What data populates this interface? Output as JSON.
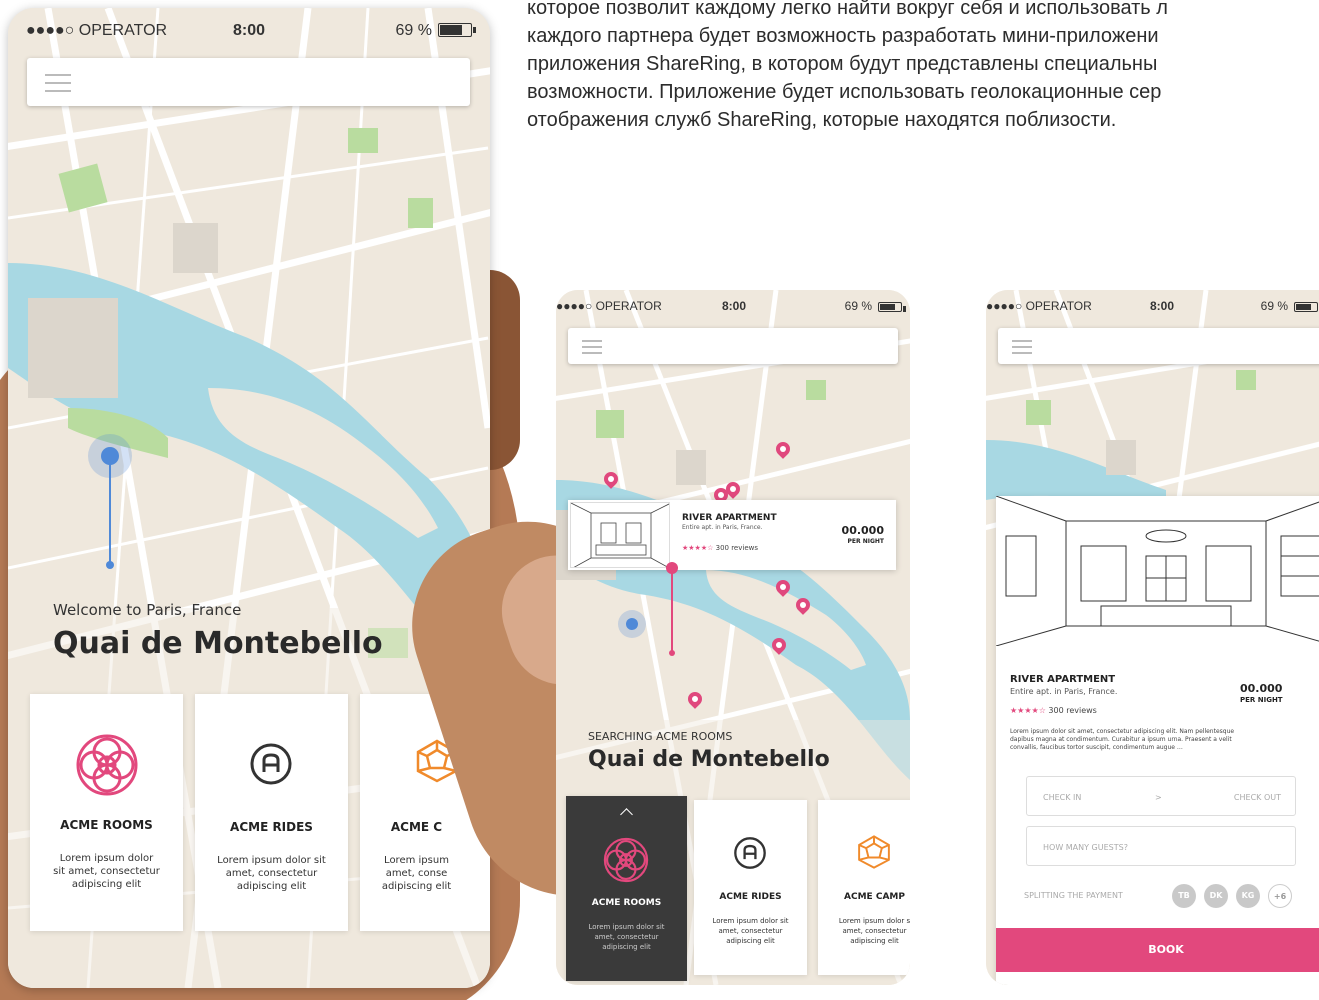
{
  "colors": {
    "accent": "#e2487d",
    "blue_marker": "#4f89d8",
    "map_bg": "#efe8dd",
    "water": "#a8d8e3",
    "park": "#b9dc9f"
  },
  "description_paragraph": [
    "которое позволит каждому легко найти вокруг себя и использовать л",
    "каждого партнера будет возможность разработать мини-приложени",
    "приложения  ShareRing, в котором будут представлены специальны",
    "возможности. Приложение будет использовать геолокационные сер",
    "отображения служб ShareRing, которые находятся поблизости."
  ],
  "status_bar": {
    "operator": "●●●●○ OPERATOR",
    "time": "8:00",
    "battery": "69 %"
  },
  "phone_left": {
    "welcome": "Welcome to Paris, France",
    "place": "Quai de Montebello",
    "cards": [
      {
        "title": "ACME ROOMS",
        "icon": "flower-icon",
        "desc": [
          "Lorem ipsum dolor",
          "sit amet, consectetur",
          "adipiscing elit"
        ]
      },
      {
        "title": "ACME RIDES",
        "icon": "circle-a-icon",
        "desc": [
          "Lorem ipsum dolor sit",
          "amet, consectetur",
          "adipiscing elit"
        ]
      },
      {
        "title": "ACME C",
        "icon": "polyhedron-icon",
        "desc": [
          "Lorem ipsum",
          "amet, conse",
          "adipiscing elit"
        ]
      }
    ]
  },
  "phone_mid": {
    "searching": "SEARCHING ACME ROOMS",
    "place": "Quai de Montebello",
    "listing": {
      "title": "RIVER APARTMENT",
      "subtitle": "Entire apt. in Paris, France.",
      "rating_stars": "★★★★☆",
      "reviews": "300 reviews",
      "price": "00.000",
      "price_unit": "PER NIGHT"
    },
    "cards": [
      {
        "title": "ACME ROOMS",
        "icon": "flower-icon",
        "desc": [
          "Lorem ipsum dolor sit",
          "amet, consectetur",
          "adipiscing elit"
        ]
      },
      {
        "title": "ACME RIDES",
        "icon": "circle-a-icon",
        "desc": [
          "Lorem ipsum dolor sit",
          "amet, consectetur",
          "adipiscing elit"
        ]
      },
      {
        "title": "ACME CAMP",
        "icon": "polyhedron-icon",
        "desc": [
          "Lorem ipsum dolor s",
          "amet, consectetur",
          "adipiscing elit"
        ]
      }
    ]
  },
  "phone_right": {
    "listing": {
      "title": "RIVER APARTMENT",
      "subtitle": "Entire apt. in Paris, France.",
      "rating_stars": "★★★★☆",
      "reviews": "300 reviews",
      "price": "00.000",
      "price_unit": "PER NIGHT"
    },
    "description": [
      "Lorem ipsum dolor sit amet, consectetur adipiscing elit. Nam pellentesque",
      "dapibus magna at condimentum. Curabitur a ipsum urna. Praesent a velit",
      "convallis, faucibus tortor suscipit, condimentum augue …"
    ],
    "check_in": "CHECK IN",
    "arrow": ">",
    "check_out": "CHECK OUT",
    "guests_placeholder": "HOW MANY GUESTS?",
    "split_label": "SPLITTING THE PAYMENT",
    "avatars": [
      "TB",
      "DK",
      "KG",
      "+6"
    ],
    "book": "BOOK"
  }
}
